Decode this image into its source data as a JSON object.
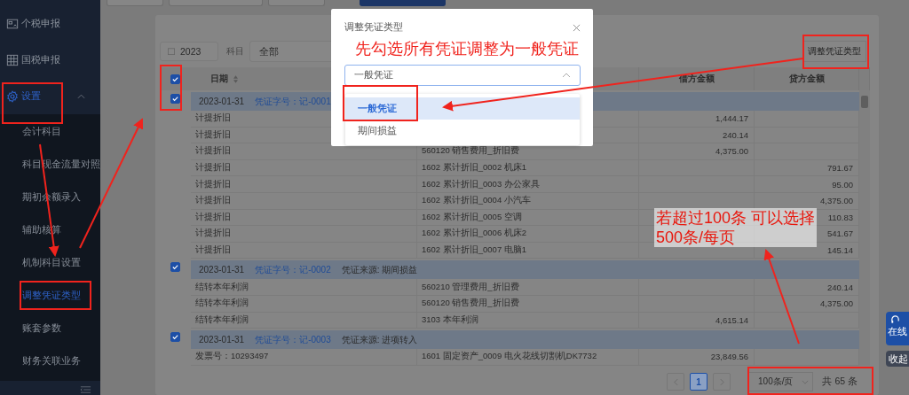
{
  "sidebar": {
    "items": [
      {
        "label": "个税申报",
        "kind": "id-card",
        "selected": false
      },
      {
        "label": "国税申报",
        "kind": "grid",
        "selected": false
      },
      {
        "label": "设置",
        "kind": "gear",
        "selected": true,
        "expanded": true,
        "children": [
          {
            "label": "会计科目",
            "selected": false
          },
          {
            "label": "科目现金流量对照",
            "selected": false
          },
          {
            "label": "期初余额录入",
            "selected": false
          },
          {
            "label": "辅助核算",
            "selected": false
          },
          {
            "label": "机制科目设置",
            "selected": false
          },
          {
            "label": "调整凭证类型",
            "selected": true
          },
          {
            "label": "账套参数",
            "selected": false
          },
          {
            "label": "财务关联业务",
            "selected": false
          }
        ]
      }
    ]
  },
  "filters": {
    "year": "2023",
    "subject_label": "科目",
    "subject_value": "全部",
    "adjust_button": "调整凭证类型"
  },
  "table": {
    "columns": [
      "日期",
      "借方金额",
      "贷方金额"
    ],
    "header_checked": true,
    "groups": [
      {
        "checked": true,
        "date": "2023-01-31",
        "voucher_no": "凭证字号：记-0001",
        "rows": [
          {
            "summary": "计提折旧",
            "debit": "1,444.17"
          },
          {
            "summary": "计提折旧",
            "debit": "240.14"
          },
          {
            "summary": "计提折旧",
            "subject": "560120 销售费用_折旧费",
            "debit": "4,375.00"
          },
          {
            "summary": "计提折旧",
            "subject": "1602 累计折旧_0002 机床1",
            "credit": "791.67"
          },
          {
            "summary": "计提折旧",
            "subject": "1602 累计折旧_0003 办公家具",
            "credit": "95.00"
          },
          {
            "summary": "计提折旧",
            "subject": "1602 累计折旧_0004 小汽车",
            "credit": "4,375.00"
          },
          {
            "summary": "计提折旧",
            "subject": "1602 累计折旧_0005 空调",
            "credit": "110.83"
          },
          {
            "summary": "计提折旧",
            "subject": "1602 累计折旧_0006 机床2",
            "credit": "541.67"
          },
          {
            "summary": "计提折旧",
            "subject": "1602 累计折旧_0007 电脑1",
            "credit": "145.14"
          }
        ]
      },
      {
        "checked": true,
        "date": "2023-01-31",
        "voucher_no": "凭证字号：记-0002",
        "source": "凭证来源: 期间损益",
        "rows": [
          {
            "summary": "结转本年利润",
            "subject": "560210 管理费用_折旧费",
            "credit": "240.14"
          },
          {
            "summary": "结转本年利润",
            "subject": "560120 销售费用_折旧费",
            "credit": "4,375.00"
          },
          {
            "summary": "结转本年利润",
            "subject": "3103 本年利润",
            "debit": "4,615.14"
          }
        ]
      },
      {
        "checked": true,
        "date": "2023-01-31",
        "voucher_no": "凭证字号：记-0003",
        "source": "凭证来源: 进项转入",
        "rows": [
          {
            "summary": "发票号：10293497",
            "subject": "1601 固定资产_0009 电火花线切割机DK7732",
            "debit": "23,849.56"
          }
        ]
      }
    ]
  },
  "pagination": {
    "pages": [
      {
        "label": "1",
        "selected": true
      }
    ],
    "page_size": "100条/页",
    "total": "共 65 条"
  },
  "modal": {
    "title": "调整凭证类型",
    "select_value": "一般凭证",
    "options": [
      {
        "label": "一般凭证",
        "selected": true
      },
      {
        "label": "期间损益",
        "selected": false
      }
    ]
  },
  "float_widget": {
    "service": "在线",
    "collapse": "收起"
  },
  "annotations": [
    {
      "lines": [
        "先勾选所有凭证调整为一般凭证"
      ]
    },
    {
      "lines": [
        "若超过100条 可以选择",
        "500条/每页"
      ]
    }
  ]
}
